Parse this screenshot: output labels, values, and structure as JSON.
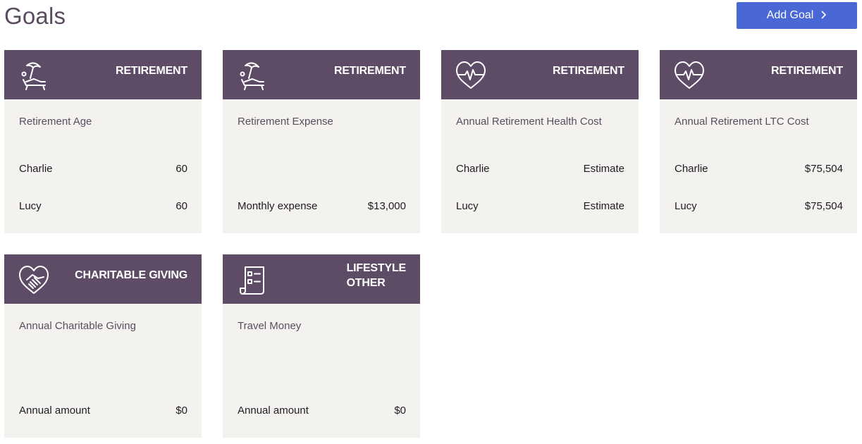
{
  "page": {
    "title": "Goals"
  },
  "toolbar": {
    "add_goal_label": "Add Goal",
    "add_goal_icon": "chevron-right-icon"
  },
  "colors": {
    "header": "#5e4c66",
    "card_bg": "#f4f2ef",
    "button": "#4a67d6"
  },
  "cards": [
    {
      "icon": "beach-chair-umbrella-icon",
      "category": "RETIREMENT",
      "goal": "Retirement Age",
      "rows": [
        {
          "label": "Charlie",
          "value": "60"
        },
        {
          "label": "Lucy",
          "value": "60"
        }
      ]
    },
    {
      "icon": "beach-chair-umbrella-icon",
      "category": "RETIREMENT",
      "goal": "Retirement Expense",
      "rows": [
        {
          "label": "Monthly expense",
          "value": "$13,000"
        }
      ]
    },
    {
      "icon": "heart-pulse-icon",
      "category": "RETIREMENT",
      "goal": "Annual Retirement Health Cost",
      "rows": [
        {
          "label": "Charlie",
          "value": "Estimate"
        },
        {
          "label": "Lucy",
          "value": "Estimate"
        }
      ]
    },
    {
      "icon": "heart-pulse-icon",
      "category": "RETIREMENT",
      "goal": "Annual Retirement LTC Cost",
      "rows": [
        {
          "label": "Charlie",
          "value": "$75,504"
        },
        {
          "label": "Lucy",
          "value": "$75,504"
        }
      ]
    },
    {
      "icon": "heart-handshake-icon",
      "category": "CHARITABLE GIVING",
      "goal": "Annual Charitable Giving",
      "rows": [
        {
          "label": "Annual amount",
          "value": "$0"
        }
      ]
    },
    {
      "icon": "checklist-scroll-icon",
      "category_line1": "LIFESTYLE",
      "category_line2": "OTHER",
      "goal": "Travel Money",
      "rows": [
        {
          "label": "Annual amount",
          "value": "$0"
        }
      ]
    }
  ]
}
